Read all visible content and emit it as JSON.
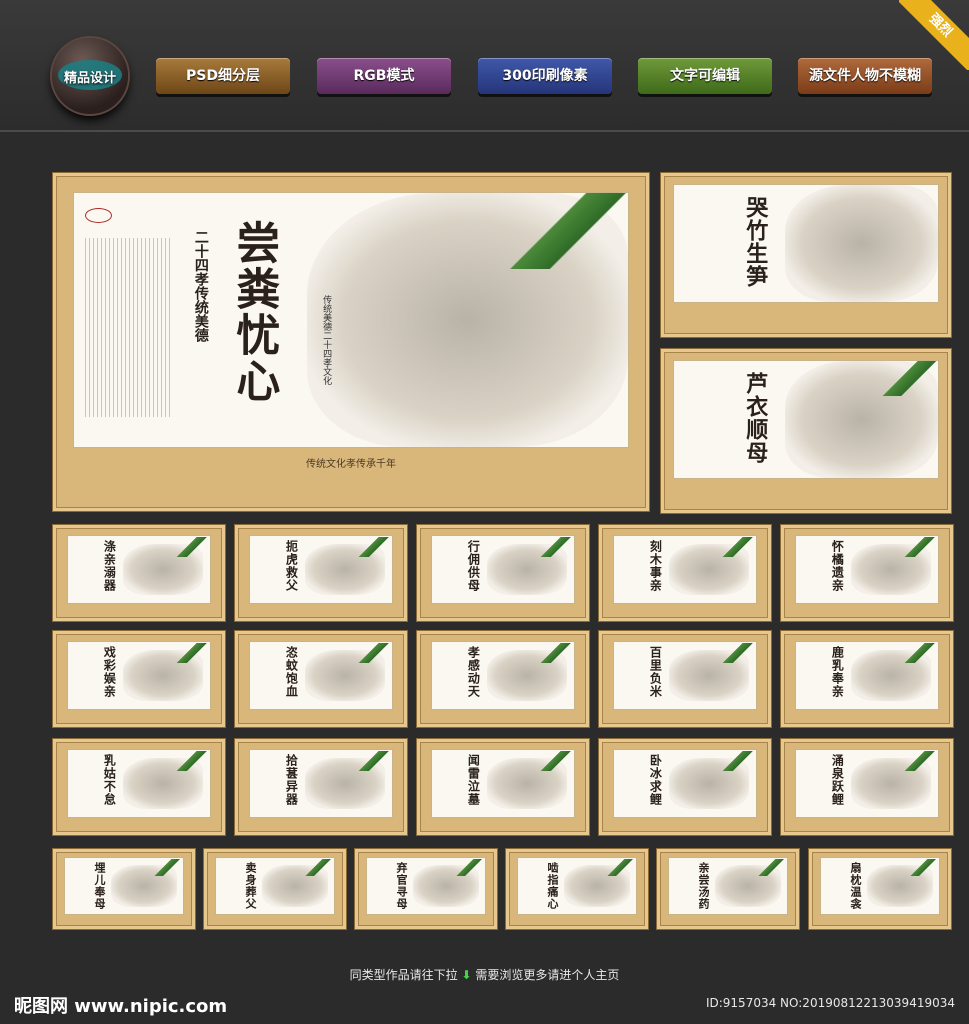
{
  "header": {
    "logo_label": "精品设计",
    "corner_ribbon": "强烈",
    "badges": [
      "PSD细分层",
      "RGB模式",
      "300印刷像素",
      "文字可编辑",
      "源文件人物不模糊"
    ]
  },
  "main_poster": {
    "title": "尝粪忧心",
    "subtitle": "二十四孝传统美德",
    "motto": "传统美德二十四孝文化",
    "banner": "传统文化孝传承千年"
  },
  "side_posters": [
    {
      "title": "哭竹生笋"
    },
    {
      "title": "芦衣顺母"
    }
  ],
  "grid_posters": [
    "涤亲溺器",
    "扼虎救父",
    "行佣供母",
    "刻木事亲",
    "怀橘遗亲",
    "戏彩娱亲",
    "恣蚊饱血",
    "孝感动天",
    "百里负米",
    "鹿乳奉亲",
    "乳姑不怠",
    "拾葚异器",
    "闻雷泣墓",
    "卧冰求鲤",
    "涌泉跃鲤",
    "埋儿奉母",
    "卖身葬父",
    "弃官寻母",
    "啮指痛心",
    "亲尝汤药",
    "扇枕温衾"
  ],
  "footer": {
    "hint": "同类型作品请往下拉",
    "hint2": "需要浏览更多请进个人主页",
    "brand": "昵图网 www.nipic.com",
    "image_id": "ID:9157034 NO:20190812213039419034"
  },
  "colors": {
    "background": "#2b2b2b",
    "frame": "#d9b77b",
    "panel": "#fbf8f2",
    "accent_green": "#4bd04b",
    "ribbon": "#e9b11b"
  }
}
